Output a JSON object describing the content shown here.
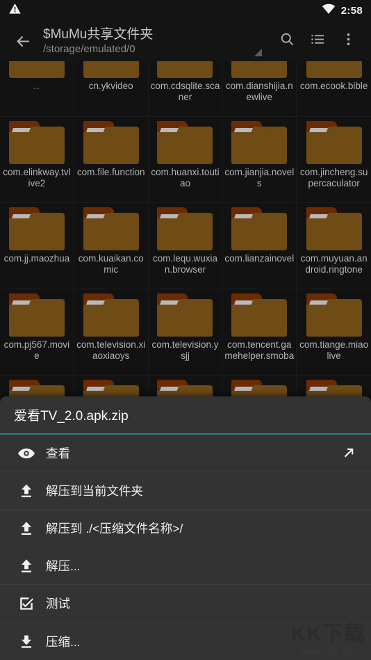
{
  "status_bar": {
    "warning_icon": "warning-triangle-icon",
    "wifi_icon": "wifi-icon",
    "time": "2:58"
  },
  "toolbar": {
    "back_icon": "arrow-back-icon",
    "title": "$MuMu共享文件夹",
    "subtitle": "/storage/emulated/0",
    "search_icon": "search-icon",
    "list_view_icon": "list-view-icon",
    "overflow_icon": "more-vertical-icon"
  },
  "grid": {
    "items": [
      {
        "label": "..",
        "kind": "parent"
      },
      {
        "label": "cn.ykvideo",
        "kind": "folder"
      },
      {
        "label": "com.cdsqlite.scaner",
        "kind": "folder"
      },
      {
        "label": "com.dianshijia.newlive",
        "kind": "folder"
      },
      {
        "label": "com.ecook.bible",
        "kind": "folder"
      },
      {
        "label": "com.elinkway.tvlive2",
        "kind": "folder"
      },
      {
        "label": "com.file.function",
        "kind": "folder"
      },
      {
        "label": "com.huanxi.toutiao",
        "kind": "folder"
      },
      {
        "label": "com.jianjia.novels",
        "kind": "folder"
      },
      {
        "label": "com.jincheng.supercaculator",
        "kind": "folder"
      },
      {
        "label": "com.jj.maozhua",
        "kind": "folder"
      },
      {
        "label": "com.kuaikan.comic",
        "kind": "folder"
      },
      {
        "label": "com.lequ.wuxian.browser",
        "kind": "folder"
      },
      {
        "label": "com.lianzainovel",
        "kind": "folder"
      },
      {
        "label": "com.muyuan.android.ringtone",
        "kind": "folder"
      },
      {
        "label": "com.pj567.movie",
        "kind": "folder"
      },
      {
        "label": "com.television.xiaoxiaoys",
        "kind": "folder"
      },
      {
        "label": "com.television.ysjj",
        "kind": "folder"
      },
      {
        "label": "com.tencent.gamehelper.smoba",
        "kind": "folder"
      },
      {
        "label": "com.tiange.miaolive",
        "kind": "folder"
      },
      {
        "label": "",
        "kind": "folder"
      },
      {
        "label": "",
        "kind": "folder"
      },
      {
        "label": "",
        "kind": "folder"
      },
      {
        "label": "",
        "kind": "folder"
      },
      {
        "label": "",
        "kind": "folder"
      }
    ]
  },
  "sheet": {
    "title": "爱看TV_2.0.apk.zip",
    "accent_color": "#2d7f8c",
    "items": [
      {
        "label": "查看",
        "icon": "eye-icon",
        "trailing_icon": "open-external-icon"
      },
      {
        "label": "解压到当前文件夹",
        "icon": "extract-up-icon",
        "trailing_icon": ""
      },
      {
        "label": "解压到 ./<压缩文件名称>/",
        "icon": "extract-up-icon",
        "trailing_icon": ""
      },
      {
        "label": "解压...",
        "icon": "extract-up-icon",
        "trailing_icon": ""
      },
      {
        "label": "测试",
        "icon": "checkbox-check-icon",
        "trailing_icon": ""
      },
      {
        "label": "压缩...",
        "icon": "compress-down-icon",
        "trailing_icon": ""
      }
    ]
  },
  "watermark": {
    "main": "KK下载",
    "sub": "www.kkx.net"
  }
}
